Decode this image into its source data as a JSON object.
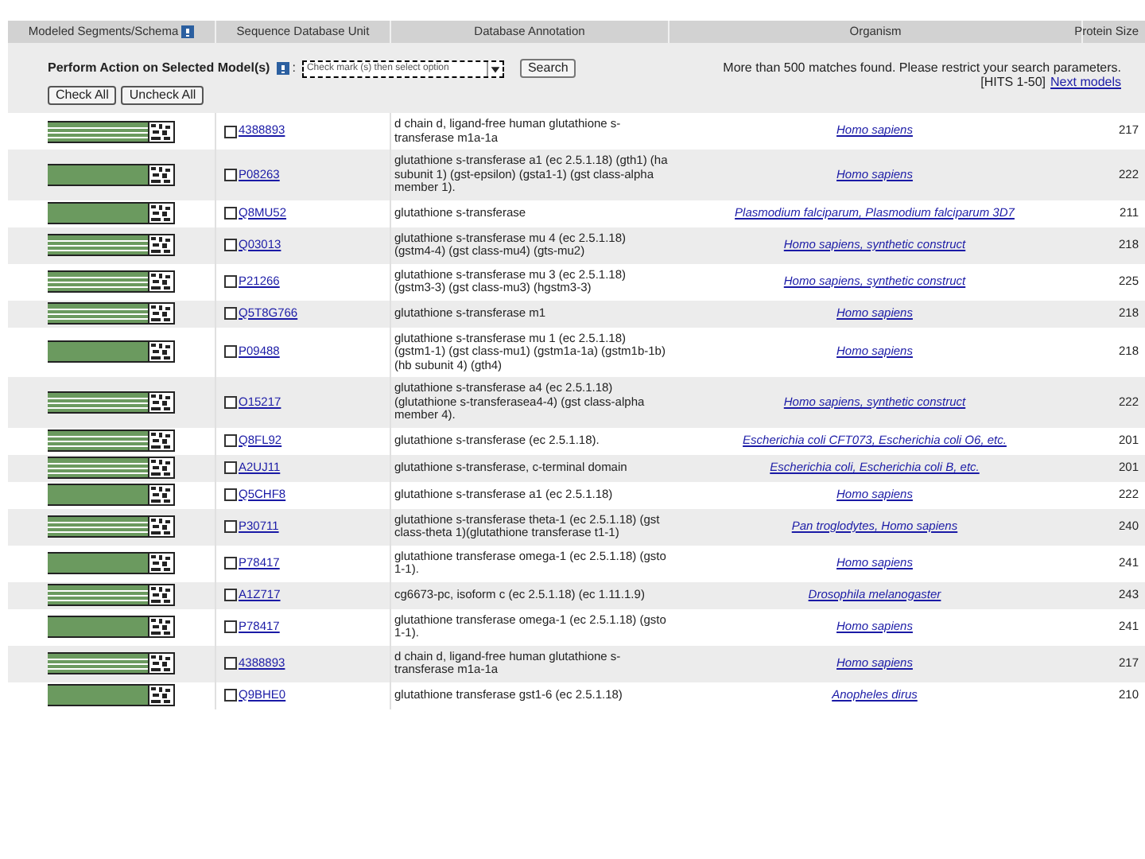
{
  "table": {
    "columns": [
      {
        "label": "Modeled Segments/Schema",
        "help": true
      },
      {
        "label": "Sequence Database Unit",
        "help": false
      },
      {
        "label": "Database Annotation",
        "help": false
      },
      {
        "label": "Organism",
        "help": false
      },
      {
        "label": "Protein Size",
        "help": false
      }
    ],
    "action_bar": {
      "label": "Perform Action on Selected Model(s)",
      "separator": ":",
      "select_value": "Check mark (s) then select option",
      "search_button": "Search",
      "message": "More than 500 matches found. Please restrict your search parameters.",
      "hits": "[HITS 1-50]",
      "next_link": "Next models",
      "buttons": [
        "Check All",
        "Uncheck All"
      ]
    },
    "rows": [
      {
        "striped": true,
        "checked": false,
        "id": "4388893",
        "annotation": "d chain d, ligand-free human glutathione s-transferase m1a-1a",
        "organism": "Homo sapiens",
        "size": "217"
      },
      {
        "striped": false,
        "checked": false,
        "id": "P08263",
        "annotation": "glutathione s-transferase a1 (ec 2.5.1.18) (gth1) (ha subunit 1) (gst-epsilon) (gsta1-1) (gst class-alpha member 1).",
        "organism": "Homo sapiens",
        "size": "222"
      },
      {
        "striped": false,
        "checked": false,
        "id": "Q8MU52",
        "annotation": "glutathione s-transferase",
        "organism": "Plasmodium falciparum, Plasmodium falciparum 3D7",
        "size": "211"
      },
      {
        "striped": true,
        "checked": false,
        "id": "Q03013",
        "annotation": "glutathione s-transferase mu 4 (ec 2.5.1.18) (gstm4-4) (gst class-mu4) (gts-mu2)",
        "organism": "Homo sapiens, synthetic construct",
        "size": "218"
      },
      {
        "striped": true,
        "checked": false,
        "id": "P21266",
        "annotation": "glutathione s-transferase mu 3 (ec 2.5.1.18) (gstm3-3) (gst class-mu3) (hgstm3-3)",
        "organism": "Homo sapiens, synthetic construct",
        "size": "225"
      },
      {
        "striped": true,
        "checked": false,
        "id": "Q5T8G766",
        "annotation": "glutathione s-transferase m1",
        "organism": "Homo sapiens",
        "size": "218"
      },
      {
        "striped": false,
        "checked": false,
        "id": "P09488",
        "annotation": "glutathione s-transferase mu 1 (ec 2.5.1.18) (gstm1-1) (gst class-mu1) (gstm1a-1a) (gstm1b-1b) (hb subunit 4) (gth4)",
        "organism": "Homo sapiens",
        "size": "218"
      },
      {
        "striped": true,
        "checked": false,
        "id": "O15217",
        "annotation": "glutathione s-transferase a4 (ec 2.5.1.18) (glutathione s-transferasea4-4) (gst class-alpha member 4).",
        "organism": "Homo sapiens, synthetic construct",
        "size": "222"
      },
      {
        "striped": true,
        "checked": false,
        "id": "Q8FL92",
        "annotation": "glutathione s-transferase (ec 2.5.1.18).",
        "organism": "Escherichia coli CFT073, Escherichia coli O6, etc.",
        "size": "201"
      },
      {
        "striped": true,
        "checked": false,
        "id": "A2UJ11",
        "annotation": "glutathione s-transferase, c-terminal domain",
        "organism": "Escherichia coli, Escherichia coli B, etc.",
        "size": "201"
      },
      {
        "striped": false,
        "checked": false,
        "id": "Q5CHF8",
        "annotation": "glutathione s-transferase a1 (ec 2.5.1.18)",
        "organism": "Homo sapiens",
        "size": "222"
      },
      {
        "striped": true,
        "checked": false,
        "id": "P30711",
        "annotation": "glutathione s-transferase theta-1 (ec 2.5.1.18) (gst class-theta 1)(glutathione transferase t1-1)",
        "organism": "Pan troglodytes, Homo sapiens",
        "size": "240"
      },
      {
        "striped": false,
        "checked": false,
        "id": "P78417",
        "annotation": "glutathione transferase omega-1 (ec 2.5.1.18) (gsto 1-1).",
        "organism": "Homo sapiens",
        "size": "241"
      },
      {
        "striped": true,
        "checked": false,
        "id": "A1Z717",
        "annotation": "cg6673-pc, isoform c (ec 2.5.1.18) (ec 1.11.1.9)",
        "organism": "Drosophila melanogaster",
        "size": "243"
      },
      {
        "striped": false,
        "checked": false,
        "id": "P78417",
        "annotation": "glutathione transferase omega-1 (ec 2.5.1.18) (gsto 1-1).",
        "organism": "Homo sapiens",
        "size": "241"
      },
      {
        "striped": true,
        "checked": false,
        "id": "4388893",
        "annotation": "d chain d, ligand-free human glutathione s-transferase m1a-1a",
        "organism": "Homo sapiens",
        "size": "217"
      },
      {
        "striped": false,
        "checked": false,
        "id": "Q9BHE0",
        "annotation": "glutathione transferase gst1-6 (ec 2.5.1.18)",
        "organism": "Anopheles dirus",
        "size": "210"
      }
    ]
  }
}
